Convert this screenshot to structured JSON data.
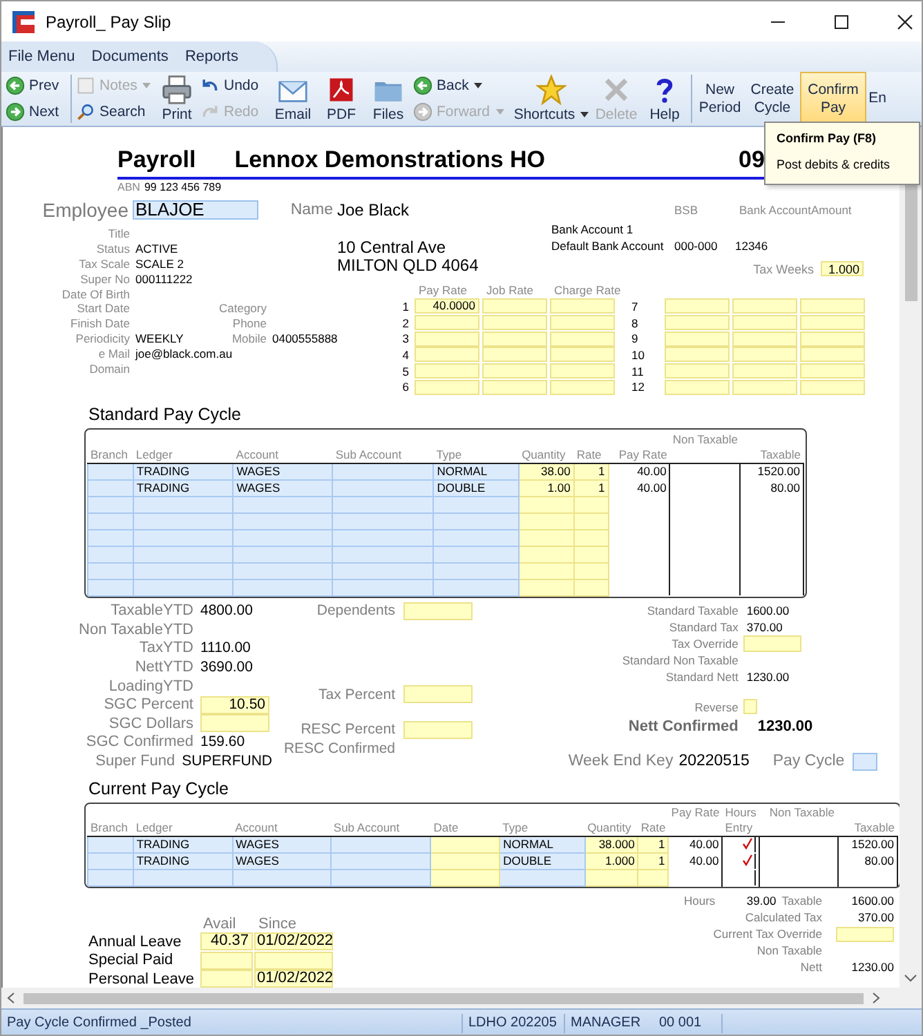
{
  "window": {
    "title": "Payroll_ Pay Slip"
  },
  "menu": [
    {
      "label": "File Menu"
    },
    {
      "label": "Documents"
    },
    {
      "label": "Reports"
    }
  ],
  "toolbar": [
    {
      "kind": "nav",
      "buttons": [
        {
          "label": "Prev",
          "disabled": false,
          "dropdown": false,
          "highlighted": false
        },
        {
          "label": "Next",
          "disabled": false,
          "dropdown": false,
          "highlighted": false
        }
      ]
    },
    {
      "kind": "tools",
      "buttons": [
        {
          "label": "Notes",
          "disabled": true,
          "dropdown": true,
          "highlighted": false
        },
        {
          "label": "Search",
          "disabled": false,
          "dropdown": false,
          "highlighted": false
        }
      ]
    },
    {
      "kind": "tools",
      "buttons": [
        {
          "label": "Print",
          "disabled": false,
          "dropdown": false,
          "highlighted": false
        }
      ]
    },
    {
      "kind": "tools",
      "buttons": [
        {
          "label": "Undo",
          "disabled": false,
          "dropdown": false,
          "highlighted": false
        },
        {
          "label": "Redo",
          "disabled": true,
          "dropdown": false,
          "highlighted": false
        }
      ]
    },
    {
      "kind": "tools",
      "buttons": [
        {
          "label": "Email",
          "disabled": false,
          "dropdown": false,
          "highlighted": false
        }
      ]
    },
    {
      "kind": "tools",
      "buttons": [
        {
          "label": "PDF",
          "disabled": false,
          "dropdown": false,
          "highlighted": false
        }
      ]
    },
    {
      "kind": "tools",
      "buttons": [
        {
          "label": "Files",
          "disabled": false,
          "dropdown": false,
          "highlighted": false
        }
      ]
    },
    {
      "kind": "tools",
      "buttons": [
        {
          "label": "Back",
          "disabled": false,
          "dropdown": true,
          "highlighted": false
        },
        {
          "label": "Forward",
          "disabled": true,
          "dropdown": true,
          "highlighted": false
        }
      ]
    },
    {
      "kind": "tools",
      "buttons": [
        {
          "label": "Shortcuts",
          "disabled": false,
          "dropdown": true,
          "highlighted": false
        }
      ]
    },
    {
      "kind": "tools",
      "buttons": [
        {
          "label": "Delete",
          "disabled": true,
          "dropdown": false,
          "highlighted": false
        }
      ]
    },
    {
      "kind": "tools",
      "buttons": [
        {
          "label": "Help",
          "disabled": false,
          "dropdown": false,
          "highlighted": false
        }
      ]
    },
    {
      "kind": "actions",
      "buttons": [
        {
          "label": "New Period",
          "disabled": false,
          "dropdown": false,
          "highlighted": false
        }
      ]
    },
    {
      "kind": "actions",
      "buttons": [
        {
          "label": "Create Cycle",
          "disabled": false,
          "dropdown": false,
          "highlighted": false
        }
      ]
    },
    {
      "kind": "actions",
      "buttons": [
        {
          "label": "Confirm Pay",
          "disabled": false,
          "dropdown": false,
          "highlighted": true
        }
      ]
    },
    {
      "kind": "actions",
      "buttons": [
        {
          "label": "En",
          "disabled": false,
          "dropdown": false,
          "highlighted": false
        }
      ]
    }
  ],
  "tooltip": {
    "title": "Confirm Pay (F8)",
    "text": "Post debits & credits"
  },
  "form": {
    "title": "Payroll",
    "company": "Lennox Demonstrations HO",
    "number": "09",
    "abn_label": "ABN",
    "abn": "99 123 456 789"
  },
  "employee": {
    "label": "Employee",
    "code": "BLAJOE",
    "name_label": "Name",
    "name": "Joe Black",
    "details": [
      {
        "label": "Title"
      },
      {
        "label": "Status",
        "value": "ACTIVE"
      },
      {
        "label": "Tax Scale",
        "value": "SCALE 2"
      },
      {
        "label": "Super No",
        "value": "000111222"
      },
      {
        "label": "Date Of Birth"
      },
      {
        "label": "Start Date"
      },
      {
        "label": "Finish Date"
      },
      {
        "label": "Periodicity",
        "value": "WEEKLY"
      },
      {
        "label": "e Mail",
        "value": "joe@black.com.au"
      },
      {
        "label": "Domain"
      }
    ],
    "contact": [
      {
        "label": "Category"
      },
      {
        "label": "Phone"
      },
      {
        "label": "Mobile",
        "value": "0400555888"
      }
    ],
    "address": [
      "10 Central Ave",
      "MILTON QLD 4064"
    ]
  },
  "bank": {
    "columns": [
      "BSB",
      "Bank Account",
      "Amount"
    ],
    "accounts": [
      {
        "name": "Bank Account 1"
      },
      {
        "name": "Default Bank Account",
        "bsb": "000-000",
        "account": "12346"
      }
    ],
    "tax_weeks_label": "Tax Weeks",
    "tax_weeks": "1.000"
  },
  "rates": {
    "columns": [
      "Pay Rate",
      "Job Rate",
      "Charge Rate"
    ],
    "rows": [
      {
        "number": "1",
        "pay_rate": "40.0000"
      },
      {
        "number": "2"
      },
      {
        "number": "3"
      },
      {
        "number": "4"
      },
      {
        "number": "5"
      },
      {
        "number": "6"
      },
      {
        "number": "7"
      },
      {
        "number": "8"
      },
      {
        "number": "9"
      },
      {
        "number": "10"
      },
      {
        "number": "11"
      },
      {
        "number": "12"
      }
    ]
  },
  "standard_pay_cycle": {
    "title": "Standard Pay Cycle",
    "columns": [
      {
        "label": "Branch",
        "kind": "lookup"
      },
      {
        "label": "Ledger",
        "kind": "lookup"
      },
      {
        "label": "Account",
        "kind": "lookup"
      },
      {
        "label": "Sub Account",
        "kind": "lookup"
      },
      {
        "label": "Type",
        "kind": "lookup"
      },
      {
        "label": "Quantity",
        "kind": "entry"
      },
      {
        "label": "Rate",
        "kind": "entry"
      },
      {
        "label": "Pay Rate",
        "kind": "calc"
      },
      {
        "label_above": "Non Taxable",
        "kind": "calc"
      },
      {
        "label": "Taxable",
        "kind": "calc"
      }
    ],
    "rows": [
      {
        "ledger": "TRADING",
        "account": "WAGES",
        "type": "NORMAL",
        "quantity": "38.00",
        "rate": "1",
        "pay_rate": "40.00",
        "taxable": "1520.00"
      },
      {
        "ledger": "TRADING",
        "account": "WAGES",
        "type": "DOUBLE",
        "quantity": "1.00",
        "rate": "1",
        "pay_rate": "40.00",
        "taxable": "80.00"
      }
    ]
  },
  "totals": {
    "left": [
      {
        "label": "TaxableYTD",
        "value": "4800.00",
        "kind": "text"
      },
      {
        "label": "Non TaxableYTD",
        "kind": "text"
      },
      {
        "label": "TaxYTD",
        "value": "1110.00",
        "kind": "text"
      },
      {
        "label": "NettYTD",
        "value": "3690.00",
        "kind": "text"
      },
      {
        "label": "LoadingYTD",
        "kind": "text"
      },
      {
        "label": "SGC Percent",
        "value": "10.50",
        "kind": "field"
      },
      {
        "label": "SGC Dollars",
        "kind": "field"
      },
      {
        "label": "SGC Confirmed",
        "value": "159.60",
        "kind": "text"
      },
      {
        "label": "Super Fund",
        "value": "SUPERFUND",
        "kind": "text"
      }
    ],
    "middle": [
      {
        "label": "Dependents",
        "kind": "field"
      },
      {
        "label": "Tax Percent",
        "kind": "field"
      },
      {
        "label": "RESC Percent",
        "kind": "field"
      },
      {
        "label": "RESC Confirmed",
        "kind": "text"
      }
    ],
    "right": [
      {
        "label": "Standard Taxable",
        "value": "1600.00",
        "kind": "text"
      },
      {
        "label": "Standard Tax",
        "value": "370.00",
        "kind": "text"
      },
      {
        "label": "Tax Override",
        "kind": "field"
      },
      {
        "label": "Standard Non Taxable",
        "kind": "text"
      },
      {
        "label": "Standard Nett",
        "value": "1230.00",
        "kind": "text"
      },
      {
        "label": "Reverse",
        "kind": "check",
        "checked": false
      },
      {
        "label": "Nett Confirmed",
        "value": "1230.00",
        "kind": "total"
      }
    ]
  },
  "week_end_key": {
    "label": "Week End Key",
    "value": "20220515"
  },
  "pay_cycle": {
    "label": "Pay Cycle"
  },
  "current_pay_cycle": {
    "title": "Current Pay Cycle",
    "columns": [
      {
        "label": "Branch",
        "kind": "lookup"
      },
      {
        "label": "Ledger",
        "kind": "lookup"
      },
      {
        "label": "Account",
        "kind": "lookup"
      },
      {
        "label": "Sub Account",
        "kind": "lookup"
      },
      {
        "label": "Date",
        "kind": "entry"
      },
      {
        "label": "Type",
        "kind": "lookup"
      },
      {
        "label": "Quantity",
        "kind": "entry"
      },
      {
        "label": "Rate",
        "kind": "entry"
      },
      {
        "label_above": "Pay Rate",
        "kind": "calc"
      },
      {
        "label_above": "Hours",
        "label": "Entry",
        "kind": "check"
      },
      {
        "label_above": "Non Taxable",
        "kind": "calc"
      },
      {
        "label": "Taxable",
        "kind": "calc"
      }
    ],
    "rows": [
      {
        "ledger": "TRADING",
        "account": "WAGES",
        "type": "NORMAL",
        "quantity": "38.000",
        "rate": "1",
        "pay_rate": "40.00",
        "hours_entry": true,
        "taxable": "1520.00"
      },
      {
        "ledger": "TRADING",
        "account": "WAGES",
        "type": "DOUBLE",
        "quantity": "1.000",
        "rate": "1",
        "pay_rate": "40.00",
        "hours_entry": true,
        "taxable": "80.00"
      }
    ]
  },
  "summary": {
    "hours_label": "Hours",
    "hours": "39.00",
    "lines": [
      {
        "label": "Taxable",
        "value": "1600.00",
        "kind": "text"
      },
      {
        "label": "Calculated Tax",
        "value": "370.00",
        "kind": "text"
      },
      {
        "label": "Current Tax Override",
        "kind": "field"
      },
      {
        "label": "Non Taxable",
        "kind": "text"
      },
      {
        "label": "Nett",
        "value": "1230.00",
        "kind": "text"
      }
    ]
  },
  "leave": {
    "columns": [
      "Avail",
      "Since"
    ],
    "rows": [
      {
        "label": "Annual Leave",
        "avail": "40.37",
        "since": "01/02/2022"
      },
      {
        "label": "Special Paid"
      },
      {
        "label": "Personal Leave",
        "since": "01/02/2022"
      }
    ]
  },
  "status_bar": [
    {
      "text": "Pay Cycle Confirmed _Posted"
    },
    {
      "text": "LDHO 202205"
    },
    {
      "text": "MANAGER"
    },
    {
      "text": "00 001"
    }
  ]
}
